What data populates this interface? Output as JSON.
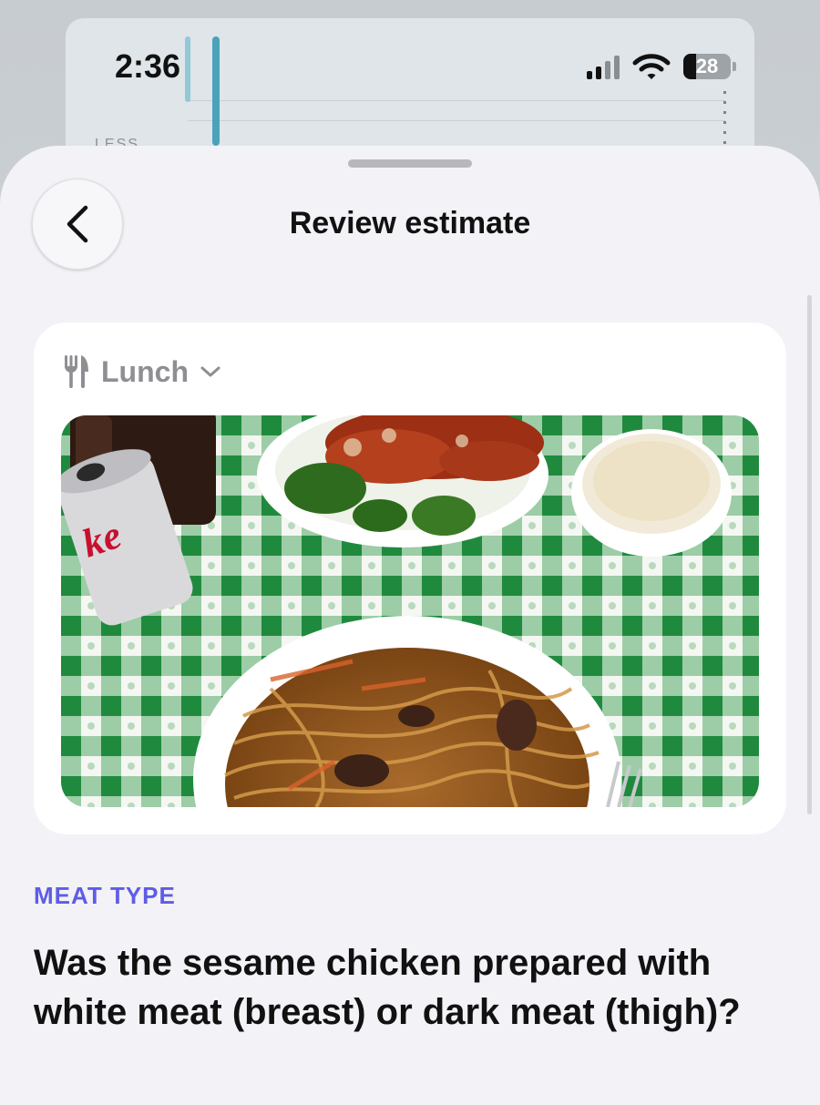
{
  "status_bar": {
    "time": "2:36",
    "battery_percent": "28"
  },
  "background": {
    "partial_label": "LESS"
  },
  "header": {
    "title": "Review estimate",
    "back_icon": "chevron-left-icon"
  },
  "meal": {
    "icon": "fork-knife-icon",
    "selected": "Lunch",
    "dropdown_icon": "chevron-down-icon",
    "photo_icon": "meal-photo"
  },
  "question": {
    "section_label": "MEAT TYPE",
    "text": "Was the sesame chicken prepared with white meat (breast) or dark meat (thigh)?"
  },
  "colors": {
    "accent": "#5e5ce6",
    "sheet_bg": "#f2f2f7",
    "card_bg": "#ffffff",
    "secondary_text": "#8e8e93",
    "tablecloth_green": "#1f8a3d"
  }
}
